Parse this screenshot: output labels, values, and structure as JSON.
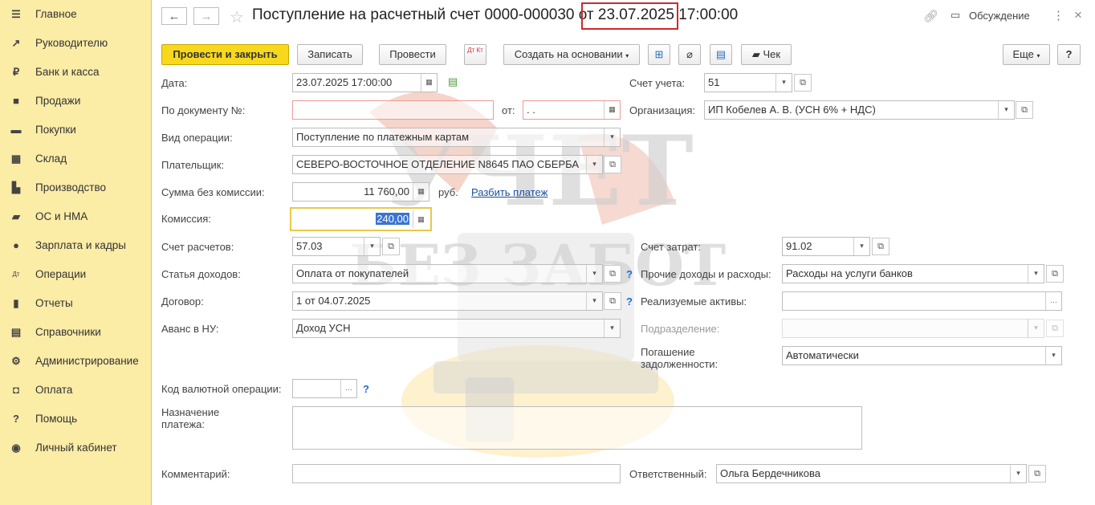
{
  "sidebar": {
    "items": [
      {
        "label": "Главное",
        "icon": "menu-icon"
      },
      {
        "label": "Руководителю",
        "icon": "trend-icon"
      },
      {
        "label": "Банк и касса",
        "icon": "ruble-icon"
      },
      {
        "label": "Продажи",
        "icon": "bag-icon"
      },
      {
        "label": "Покупки",
        "icon": "cart-icon"
      },
      {
        "label": "Склад",
        "icon": "warehouse-icon"
      },
      {
        "label": "Производство",
        "icon": "factory-icon"
      },
      {
        "label": "ОС и НМА",
        "icon": "truck-icon"
      },
      {
        "label": "Зарплата и кадры",
        "icon": "person-icon"
      },
      {
        "label": "Операции",
        "icon": "dt-kt-icon"
      },
      {
        "label": "Отчеты",
        "icon": "bar-chart-icon"
      },
      {
        "label": "Справочники",
        "icon": "books-icon"
      },
      {
        "label": "Администрирование",
        "icon": "gear-icon"
      },
      {
        "label": "Оплата",
        "icon": "wallet-icon"
      },
      {
        "label": "Помощь",
        "icon": "question-icon"
      },
      {
        "label": "Личный кабинет",
        "icon": "user-circle-icon"
      }
    ]
  },
  "header": {
    "title_prefix": "Поступление на расчетный счет 0000-000030 от ",
    "title_date": "23.07.2025 17:00:00",
    "discussion": "Обсуждение"
  },
  "toolbar": {
    "post_close": "Провести и закрыть",
    "save": "Записать",
    "post": "Провести",
    "dtkt": "Дт Кт",
    "create_based": "Создать на основании",
    "check": "Чек",
    "more": "Еще",
    "help": "?"
  },
  "form": {
    "date_label": "Дата:",
    "date_value": "23.07.2025 17:00:00",
    "docnum_label": "По документу №:",
    "docnum_value": "",
    "from_label": "от:",
    "from_value": " .  .",
    "optype_label": "Вид операции:",
    "optype_value": "Поступление по платежным картам",
    "payer_label": "Плательщик:",
    "payer_value": "СЕВЕРО-ВОСТОЧНОЕ ОТДЕЛЕНИЕ N8645 ПАО СБЕРБА",
    "sum_label": "Сумма без комиссии:",
    "sum_value": "11 760,00",
    "currency": "руб.",
    "split_link": "Разбить платеж",
    "commission_label": "Комиссия:",
    "commission_value": "240,00",
    "settle_acc_label": "Счет расчетов:",
    "settle_acc_value": "57.03",
    "income_item_label": "Статья доходов:",
    "income_item_value": "Оплата от покупателей",
    "contract_label": "Договор:",
    "contract_value": "1 от 04.07.2025",
    "advance_label": "Аванс в НУ:",
    "advance_value": "Доход УСН",
    "currency_op_label": "Код валютной операции:",
    "currency_op_value": "",
    "purpose_label_1": "Назначение",
    "purpose_label_2": "платежа:",
    "comment_label": "Комментарий:",
    "comment_value": "",
    "account_label": "Счет учета:",
    "account_value": "51",
    "org_label": "Организация:",
    "org_value": "ИП Кобелев А. В. (УСН 6% + НДС)",
    "expense_acc_label": "Счет затрат:",
    "expense_acc_value": "91.02",
    "other_inc_label": "Прочие доходы и расходы:",
    "other_inc_value": "Расходы на услуги банков",
    "assets_label": "Реализуемые активы:",
    "assets_value": "",
    "division_label": "Подразделение:",
    "division_value": "",
    "debt_label_1": "Погашение",
    "debt_label_2": "задолженности:",
    "debt_value": "Автоматически",
    "responsible_label": "Ответственный:",
    "responsible_value": "Ольга Бердечникова"
  },
  "watermark": {
    "line1": "УЧЕТ",
    "line2": "БЕЗ ЗАБОТ"
  },
  "colors": {
    "sidebar": "#fbeca6",
    "primary": "#f8d81c",
    "highlight": "#cc2b2b",
    "link": "#1a4f9e"
  }
}
